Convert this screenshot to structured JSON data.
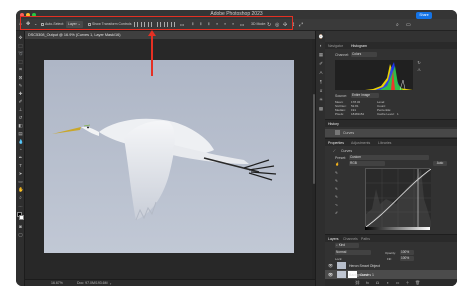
{
  "window": {
    "title": "Adobe Photoshop 2023",
    "share_label": "Share",
    "traffic_lights": {
      "close": "#ff5f57",
      "minimize": "#febc2e",
      "maximize": "#28c840"
    }
  },
  "options_bar": {
    "auto_select_label": "Auto-Select:",
    "auto_select_value": "Layer",
    "transform_controls_label": "Show Transform Controls",
    "mode_label": "3D Mode:"
  },
  "annotation": {
    "color": "#e53023"
  },
  "document": {
    "tab_label": "DSC5308_Output @ 16.9% (Curves 1, Layer Mask/16)",
    "zoom": "16.67%",
    "doc_info": "Doc: 97.0M/193.6M"
  },
  "panels": {
    "top_tabs": [
      "Navigator",
      "Histogram"
    ],
    "histogram": {
      "channel_label": "Channel:",
      "channel_value": "Colors",
      "source_label": "Source:",
      "source_value": "Entire Image",
      "stats_left": [
        "Mean:",
        "Std Dev:",
        "Median:",
        "Pixels:"
      ],
      "stats_left_values": [
        "178.32",
        "52.81",
        "191",
        "18481152"
      ],
      "stats_right": [
        "Level:",
        "Count:",
        "Percentile:",
        "Cache Level:"
      ],
      "stats_right_values": [
        "",
        "",
        "",
        "1"
      ]
    },
    "history_tab": "History",
    "history_item": "Curves",
    "properties_tabs": [
      "Properties",
      "Adjustments",
      "Libraries"
    ],
    "curves": {
      "title": "Curves",
      "preset_label": "Preset:",
      "preset_value": "Custom",
      "channel_value": "RGB",
      "auto_label": "Auto"
    },
    "layers_tabs": [
      "Layers",
      "Channels",
      "Paths"
    ],
    "layers_filter": "Kind",
    "blend_mode": "Normal",
    "opacity_label": "Opacity:",
    "opacity_value": "100%",
    "lock_label": "Lock:",
    "fill_label": "Fill:",
    "fill_value": "100%",
    "layers": [
      {
        "name": "Heron Smart Object"
      },
      {
        "name": "Curves 1"
      },
      {
        "name": "Background"
      }
    ]
  }
}
